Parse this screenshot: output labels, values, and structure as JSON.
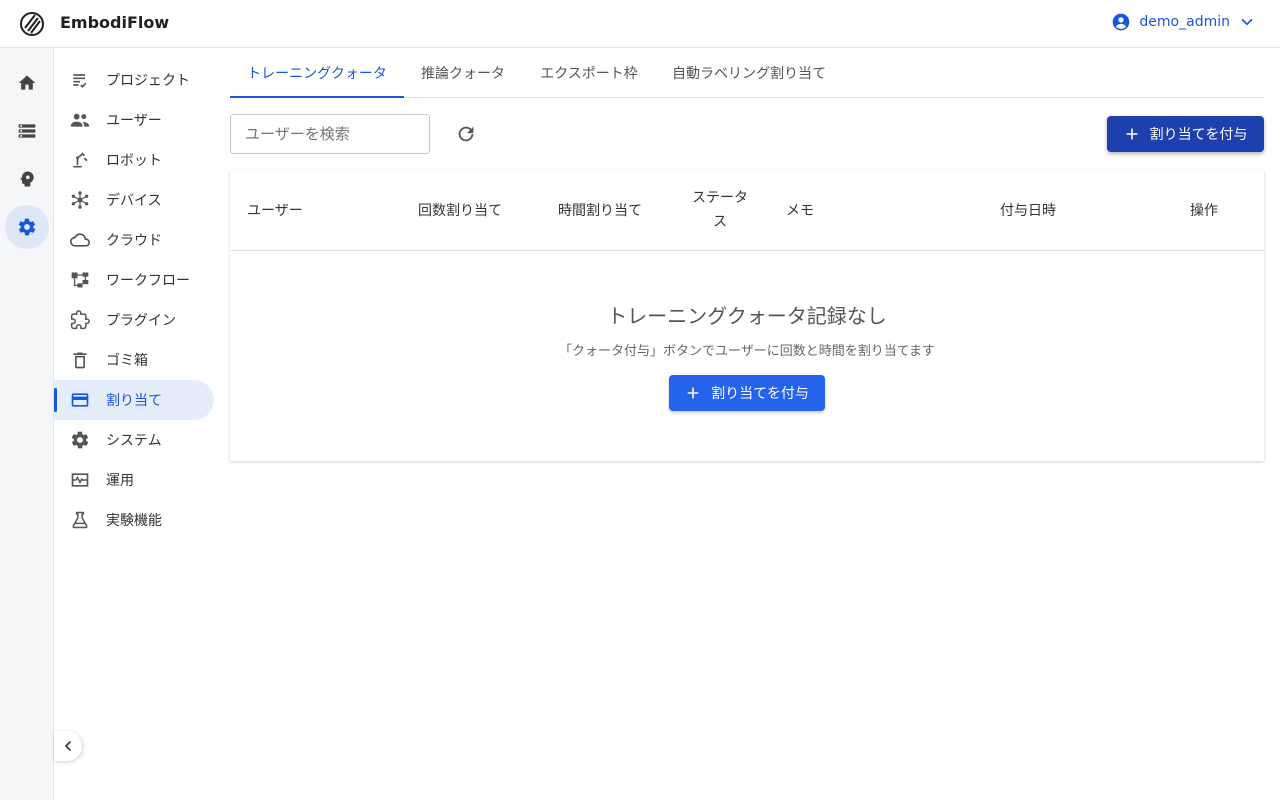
{
  "app": {
    "title": "EmbodiFlow"
  },
  "user": {
    "name": "demo_admin"
  },
  "rail": {
    "items": [
      {
        "icon": "home-icon"
      },
      {
        "icon": "storage-icon"
      },
      {
        "icon": "psychology-icon"
      },
      {
        "icon": "settings-icon",
        "active": true
      }
    ]
  },
  "sidebar": {
    "items": [
      {
        "label": "プロジェクト",
        "icon": "list-checks-icon"
      },
      {
        "label": "ユーザー",
        "icon": "people-icon"
      },
      {
        "label": "ロボット",
        "icon": "robot-arm-icon"
      },
      {
        "label": "デバイス",
        "icon": "hub-icon"
      },
      {
        "label": "クラウド",
        "icon": "cloud-icon"
      },
      {
        "label": "ワークフロー",
        "icon": "workflow-icon"
      },
      {
        "label": "プラグイン",
        "icon": "puzzle-icon"
      },
      {
        "label": "ゴミ箱",
        "icon": "trash-icon"
      },
      {
        "label": "割り当て",
        "icon": "card-icon",
        "active": true
      },
      {
        "label": "システム",
        "icon": "gear-icon"
      },
      {
        "label": "運用",
        "icon": "monitor-heart-icon"
      },
      {
        "label": "実験機能",
        "icon": "flask-icon"
      }
    ]
  },
  "tabs": [
    {
      "label": "トレーニングクォータ",
      "active": true
    },
    {
      "label": "推論クォータ"
    },
    {
      "label": "エクスポート枠"
    },
    {
      "label": "自動ラベリング割り当て"
    }
  ],
  "toolbar": {
    "search_placeholder": "ユーザーを検索",
    "grant_label": "割り当てを付与"
  },
  "table": {
    "headers": [
      "ユーザー",
      "回数割り当て",
      "時間割り当て",
      "ステータス",
      "メモ",
      "付与日時",
      "操作"
    ],
    "rows": []
  },
  "empty": {
    "title": "トレーニングクォータ記録なし",
    "subtitle": "「クォータ付与」ボタンでユーザーに回数と時間を割り当てます",
    "button_label": "割り当てを付与"
  },
  "colors": {
    "accent": "#1a56db",
    "primary_button": "#1e40af",
    "button": "#2563eb"
  }
}
